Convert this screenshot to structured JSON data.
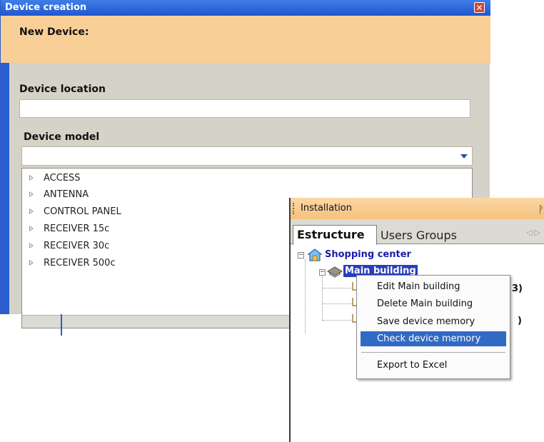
{
  "dialog": {
    "title": "Device creation",
    "close_glyph": "✕",
    "header": "New Device:",
    "location_label": "Device location",
    "location_value": "",
    "model_label": "Device model",
    "model_value": "",
    "model_options": [
      "ACCESS",
      "ANTENNA",
      "CONTROL PANEL",
      "RECEIVER 15c",
      "RECEIVER 30c",
      "RECEIVER 500c"
    ]
  },
  "panel": {
    "title": "Installation",
    "pin_glyph": "ᚹ",
    "tabs": [
      "Estructure",
      "Users Groups"
    ],
    "tab_nav": "◁▷",
    "tree": {
      "root": "Shopping center",
      "selected": "Main building",
      "partial_1": "3)",
      "partial_2": ")"
    }
  },
  "context_menu": {
    "items": [
      "Edit Main building",
      "Delete Main building",
      "Save device memory",
      "Check device memory",
      "Export to Excel"
    ],
    "highlighted_index": 3
  },
  "colors": {
    "title_blue": "#2256cf",
    "header_orange": "#f9cf98",
    "selection_blue": "#316ac5",
    "tree_text": "#1c1ca8"
  }
}
